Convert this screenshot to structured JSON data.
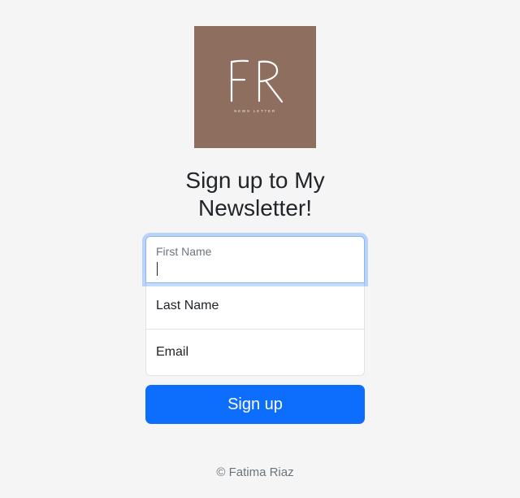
{
  "logo": {
    "monogram": "FR",
    "tagline": "NEWS LETTER",
    "background_color": "#8e6e5e"
  },
  "heading": "Sign up to My Newsletter!",
  "form": {
    "first_name": {
      "label": "First Name",
      "value": ""
    },
    "last_name": {
      "label": "Last Name",
      "value": ""
    },
    "email": {
      "label": "Email",
      "value": ""
    }
  },
  "submit_label": "Sign up",
  "accent_color": "#0d6efd",
  "footer": "© Fatima Riaz"
}
